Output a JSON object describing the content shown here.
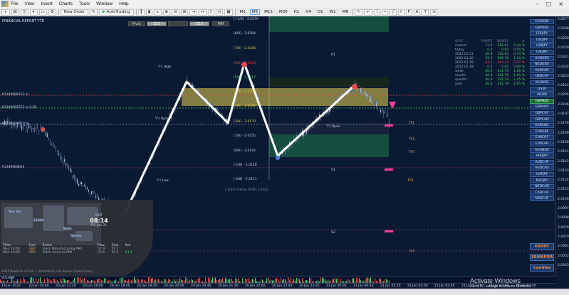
{
  "menu": [
    "File",
    "View",
    "Insert",
    "Charts",
    "Tools",
    "Window",
    "Help"
  ],
  "window_controls": [
    "–",
    "□",
    "×"
  ],
  "toolbar": {
    "new_order": "New Order",
    "autotrading": "AutoTrading",
    "timeframes": [
      "M1",
      "M5",
      "M15",
      "M30",
      "H1",
      "H4",
      "D1",
      "W1",
      "MN"
    ],
    "active_timeframe": "M5"
  },
  "chart": {
    "title": "FINANCIAL REPORT YTD",
    "header_buttons": [
      "Pivot",
      "Z21",
      "",
      "Z23",
      "MM"
    ],
    "levels_left": [
      {
        "text": "[+1/8] - 2.0279",
        "color": "white"
      },
      {
        "text": "[8/8] - 2.0264",
        "color": "white"
      },
      {
        "text": "[7/8] - 2.0248",
        "color": "yellow"
      },
      {
        "text": "[6/8] - 2.0233",
        "color": "red"
      },
      {
        "text": "[5/8] - 2.0217",
        "color": "green"
      },
      {
        "text": "[4/8] - 2.0201",
        "color": "yellow"
      },
      {
        "text": "[3/8] - 2.0186",
        "color": "yellow"
      },
      {
        "text": "[2/8] - 2.0170",
        "color": "yellow"
      },
      {
        "text": "[1/8] - 2.0155",
        "color": "white"
      },
      {
        "text": "[0/8] - 2.0142",
        "color": "white"
      },
      {
        "text": "[-1/8] - 2.0126",
        "color": "white"
      },
      {
        "text": "[-2/8] - 2.0111",
        "color": "white"
      }
    ],
    "frame_note": "[-1/3m Frame Shift] 2.0102",
    "left_markers": [
      "#13499B8723 sl",
      "#13499B8723 sl 2.38",
      "#13499B8623 tp",
      "#13499B8624"
    ],
    "labels": [
      "Y's High",
      "Y's Open",
      "Y's Low",
      "T's Open",
      "R1",
      "S1",
      "S2"
    ],
    "right_tags": [
      "TP1",
      "TP2",
      "TP3",
      "TP4",
      "TP5"
    ],
    "prices": [
      "2.0279",
      "2.0264",
      "2.0248",
      "2.0233",
      "2.0217",
      "2.0201",
      "2.0186",
      "2.0170",
      "2.0155",
      "2.0142",
      "2.0126",
      "2.0111",
      "2.0102",
      "2.0097"
    ]
  },
  "price_axis": [
    "2.02770",
    "2.02680",
    "2.02590",
    "2.02500",
    "2.02410",
    "2.02320",
    "2.02230",
    "2.02140",
    "2.02050",
    "2.01960",
    "2.01870",
    "2.01780",
    "2.01690",
    "2.01600",
    "2.01510",
    "2.01420",
    "2.01330",
    "2.01240",
    "2.01150",
    "2.01060",
    "2.00970",
    "2.00880",
    "2.00790",
    "2.00700",
    "2.00610",
    "2.00520",
    "2.00430"
  ],
  "time_axis": [
    "19 Jan 2022",
    "20 Jan 16:40",
    "20 Jan 17:20",
    "20 Jan 18:00",
    "20 Jan 18:40",
    "20 Jan 19:20",
    "20 Jan 20:00",
    "20 Jan 20:40",
    "20 Jan 21:20",
    "20 Jan 22:00",
    "20 Jan 22:40",
    "20 Jan 23:20",
    "21 Jan 00:00",
    "21 Jan 00:40",
    "21 Jan 01:20",
    "21 Jan 02:00",
    "21 Jan 02:40",
    "21 Jan 03:20",
    "21 Jan 04:00",
    "21 Jan 04:40"
  ],
  "volume_label": "VOLUME",
  "stats": {
    "headers": [
      "DATE",
      "POINTS",
      "MONEY",
      "%"
    ],
    "rows": [
      [
        "current",
        "13.8",
        "181.82",
        "0.24 %",
        "pos"
      ],
      [
        "today",
        "0.0",
        "0.00",
        "0.00 %",
        "pos"
      ],
      [
        "2022.01.21",
        "40.8",
        "182.62",
        "0.74 %",
        "pos"
      ],
      [
        "2022.01.20",
        "32.3",
        "966.26",
        "1.24 %",
        "pos"
      ],
      [
        "2022.01.19",
        "-24.6",
        "-195.33",
        "-0.07 %",
        "neg"
      ],
      [
        "2022.01.18",
        "0.0",
        "0.00",
        "0.00 %",
        "pos"
      ],
      [
        "week",
        "40.8",
        "241.79",
        "1.05 %",
        "pos"
      ],
      [
        "month",
        "40.8",
        "241.79",
        "1.05 %",
        "pos"
      ],
      [
        "quarter",
        "40.8",
        "241.79",
        "1.05 %",
        "pos"
      ],
      [
        "year",
        "40.8",
        "241.79",
        "1.05 %",
        "pos"
      ]
    ]
  },
  "symbols": [
    "EURUSD",
    "GBPUSD",
    "EURJPY",
    "USDJPY",
    "GBPJPY",
    "CADJPY",
    "AUDUSD",
    "NZDUSD",
    "USDCAD",
    "USDCHF",
    "XAUUSD",
    "US30",
    "UK100",
    "GBPNZD",
    "GBPAUD",
    "GBPCHF",
    "GBPCAD",
    "EURAUD",
    "EURGBP",
    "EURCHF",
    "EURCAD",
    "AUDNZD",
    "AUDJPY",
    "AUDCHF",
    "AUDCAD",
    "CHFJPY",
    "NZDJPY",
    "NZDCAD",
    "CADCHF",
    "NZDCHF"
  ],
  "active_symbol": "GBPNZD",
  "actions": [
    "ENTRY",
    "SEMAFOR",
    "Candles"
  ],
  "session": {
    "clock_label": "GMT",
    "time": "08:14",
    "date": "Fri, Jan 21",
    "markets": [
      "New York",
      "London",
      "Tokyo",
      "Sydney"
    ],
    "news_headers": [
      "Time",
      "Curr.",
      "Event",
      "Prev.",
      "Fcst.",
      "Act."
    ],
    "news": [
      [
        "Mon 10:00",
        "GBP",
        "Flash Manufacturing PMI",
        "57.9",
        "57.7",
        ""
      ],
      [
        "Mon 10:00",
        "GBP",
        "Flash Services PMI",
        "53.6",
        "55.2",
        "53.9"
      ]
    ]
  },
  "footer_credit": "SMFX Newsinfo v1.0.4 — fxmastersfx.com   Source: Forex Factory",
  "watermark": {
    "title": "Activate Windows",
    "sub": "Go to PC settings to activate Windows."
  },
  "colors": {
    "bg": "#0b1a33",
    "up": "#4fd06a",
    "down": "#e24c4c",
    "zone_yellow": "#e6cf4a",
    "zone_green": "#1e7a4a"
  }
}
